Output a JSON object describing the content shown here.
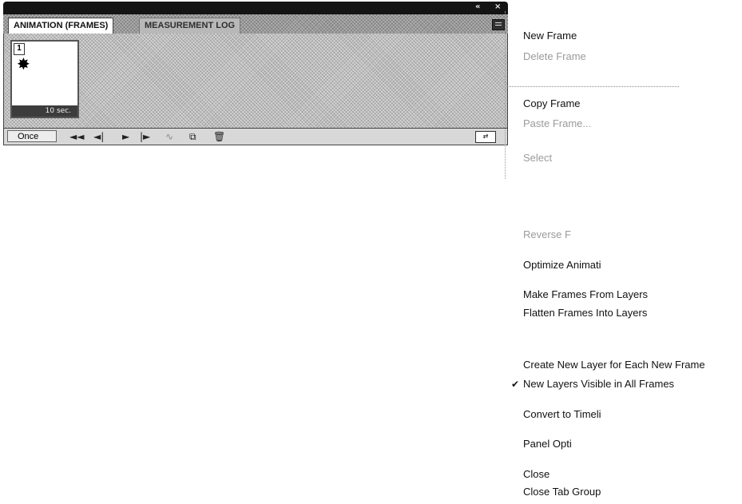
{
  "panel": {
    "tabs": [
      {
        "label": "ANIMATION (FRAMES)",
        "active": true
      },
      {
        "label": "MEASUREMENT LOG",
        "active": false
      }
    ],
    "titlebar": {
      "collapse_glyph": "«",
      "close_glyph": "×"
    },
    "frames": [
      {
        "number": "1",
        "delay": "10 sec."
      }
    ],
    "loop_option": "Once",
    "controls": {
      "first": "◄◄",
      "prev": "◄|",
      "play": "►",
      "next": "|►",
      "tween": "∿",
      "duplicate": "⧉",
      "delete": "🗑"
    }
  },
  "menu": {
    "items": [
      {
        "label": "New Frame",
        "enabled": true
      },
      {
        "label": "Delete Frame",
        "enabled": false
      },
      {
        "label": "Copy Frame",
        "enabled": true
      },
      {
        "label": "Paste Frame...",
        "enabled": false
      },
      {
        "label": "Select",
        "enabled": false
      },
      {
        "label": "Reverse F",
        "enabled": false
      },
      {
        "label": "Optimize Animati",
        "enabled": true
      },
      {
        "label": "Make Frames From Layers",
        "enabled": true
      },
      {
        "label": "Flatten Frames Into Layers",
        "enabled": true
      },
      {
        "label": "Create New Layer for Each New Frame",
        "enabled": true
      },
      {
        "label": "New Layers Visible in All Frames",
        "enabled": true,
        "checked": true
      },
      {
        "label": "Convert to Timeli",
        "enabled": true
      },
      {
        "label": "Panel Opti",
        "enabled": true
      },
      {
        "label": "Close",
        "enabled": true
      },
      {
        "label": "Close Tab Group",
        "enabled": true
      }
    ],
    "check_glyph": "✔"
  },
  "colors": {
    "titlebar": "#141414",
    "disabled_text": "#9b9b9b",
    "frame_delay_bg": "#3c3c3c"
  }
}
